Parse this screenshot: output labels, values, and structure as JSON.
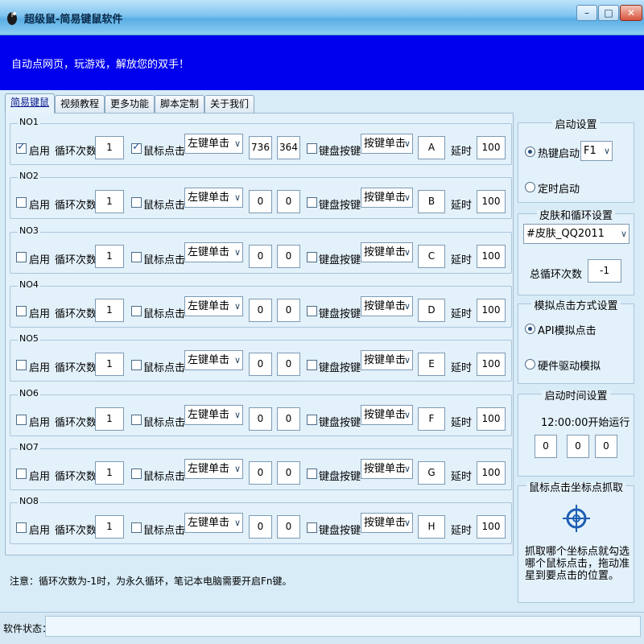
{
  "window": {
    "title": "超级鼠-简易键鼠软件",
    "minimize_label": "–",
    "maximize_label": "□",
    "close_label": "✕"
  },
  "banner": {
    "text": "自动点网页，玩游戏，解放您的双手！"
  },
  "tabs": [
    {
      "label": "简易键鼠",
      "active": true
    },
    {
      "label": "视频教程",
      "active": false
    },
    {
      "label": "更多功能",
      "active": false
    },
    {
      "label": "脚本定制",
      "active": false
    },
    {
      "label": "关于我们",
      "active": false
    }
  ],
  "row_labels": {
    "enable": "启用",
    "loop_count": "循环次数",
    "mouse_click": "鼠标点击",
    "keyboard_press": "键盘按键",
    "delay": "延时"
  },
  "rows": [
    {
      "title": "NO1",
      "enabled": true,
      "loops": "1",
      "mouse_checked": true,
      "mouse_action": "左键单击",
      "x": "736",
      "y": "364",
      "key_checked": false,
      "key_action": "按键单击",
      "key": "A",
      "delay": "100"
    },
    {
      "title": "NO2",
      "enabled": false,
      "loops": "1",
      "mouse_checked": false,
      "mouse_action": "左键单击",
      "x": "0",
      "y": "0",
      "key_checked": false,
      "key_action": "按键单击",
      "key": "B",
      "delay": "100"
    },
    {
      "title": "NO3",
      "enabled": false,
      "loops": "1",
      "mouse_checked": false,
      "mouse_action": "左键单击",
      "x": "0",
      "y": "0",
      "key_checked": false,
      "key_action": "按键单击",
      "key": "C",
      "delay": "100"
    },
    {
      "title": "NO4",
      "enabled": false,
      "loops": "1",
      "mouse_checked": false,
      "mouse_action": "左键单击",
      "x": "0",
      "y": "0",
      "key_checked": false,
      "key_action": "按键单击",
      "key": "D",
      "delay": "100"
    },
    {
      "title": "NO5",
      "enabled": false,
      "loops": "1",
      "mouse_checked": false,
      "mouse_action": "左键单击",
      "x": "0",
      "y": "0",
      "key_checked": false,
      "key_action": "按键单击",
      "key": "E",
      "delay": "100"
    },
    {
      "title": "NO6",
      "enabled": false,
      "loops": "1",
      "mouse_checked": false,
      "mouse_action": "左键单击",
      "x": "0",
      "y": "0",
      "key_checked": false,
      "key_action": "按键单击",
      "key": "F",
      "delay": "100"
    },
    {
      "title": "NO7",
      "enabled": false,
      "loops": "1",
      "mouse_checked": false,
      "mouse_action": "左键单击",
      "x": "0",
      "y": "0",
      "key_checked": false,
      "key_action": "按键单击",
      "key": "G",
      "delay": "100"
    },
    {
      "title": "NO8",
      "enabled": false,
      "loops": "1",
      "mouse_checked": false,
      "mouse_action": "左键单击",
      "x": "0",
      "y": "0",
      "key_checked": false,
      "key_action": "按键单击",
      "key": "H",
      "delay": "100"
    }
  ],
  "notice": "注意：循环次数为-1时，为永久循环，笔记本电脑需要开启Fn键。",
  "startup": {
    "title": "启动设置",
    "hotkey_label": "热键启动",
    "hotkey_selected": true,
    "hotkey_value": "F1",
    "timer_label": "定时启动",
    "timer_selected": false
  },
  "skin": {
    "title": "皮肤和循环设置",
    "skin_value": "#皮肤_QQ2011",
    "total_loops_label": "总循环次数",
    "total_loops_value": "-1"
  },
  "click_mode": {
    "title": "模拟点击方式设置",
    "api_label": "API模拟点击",
    "api_selected": true,
    "hardware_label": "硬件驱动模拟",
    "hardware_selected": false
  },
  "start_time": {
    "title": "启动时间设置",
    "caption": "12:00:00开始运行",
    "hour": "0",
    "minute": "0",
    "second": "0"
  },
  "capture": {
    "title": "鼠标点击坐标点抓取",
    "help_text": "抓取哪个坐标点就勾选哪个鼠标点击，拖动准星到要点击的位置。"
  },
  "status": {
    "label": "软件状态：",
    "value": ""
  },
  "colors": {
    "banner": "#0000ee",
    "accent": "#1a4f9a"
  }
}
